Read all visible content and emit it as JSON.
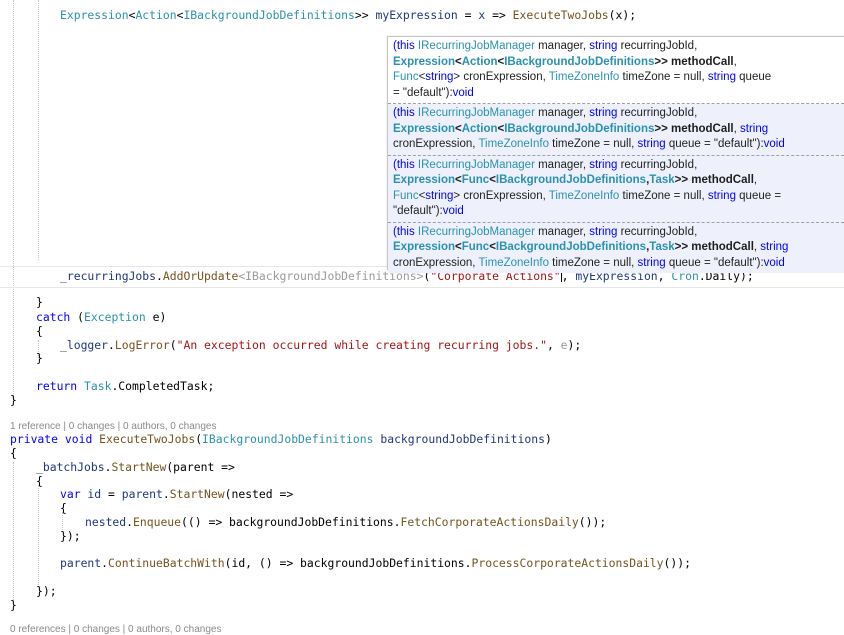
{
  "code": {
    "expr_type": "Expression",
    "expr_lt": "<",
    "expr_action": "Action",
    "expr_lt2": "<",
    "expr_iface": "IBackgroundJobDefinitions",
    "expr_gt": ">> ",
    "expr_var": "myExpression",
    "expr_eq": " = ",
    "expr_x": "x",
    "expr_arrow": " => ",
    "expr_call": "ExecuteTwoJobs",
    "expr_args": "(x);",
    "add_field": "_recurringJobs",
    "add_dot": ".",
    "add_method": "AddOrUpdate",
    "add_generic": "<IBackgroundJobDefinitions>",
    "add_open": "(",
    "add_str": "\"Corporate Actions\"",
    "add_comma": ", ",
    "add_arg2": "myExpression",
    "add_comma2": ", ",
    "add_cron": "Cron",
    "add_rest": ".Daily);",
    "close_brace1": "}",
    "catch_kw": "catch",
    "catch_open": " (",
    "catch_type": "Exception",
    "catch_var": " e)",
    "open_brace1": "{",
    "log_field": "_logger",
    "log_dot": ".",
    "log_method": "LogError",
    "log_open": "(",
    "log_str": "\"An exception occurred while creating recurring jobs.\"",
    "log_comma": ", ",
    "log_e": "e",
    "log_close": ");",
    "close_brace2": "}",
    "ret_kw": "return",
    "ret_sp": " ",
    "ret_type": "Task",
    "ret_rest": ".CompletedTask;",
    "close_brace3": "}",
    "codelens1": "1 reference | 0 changes | 0 authors, 0 changes",
    "m_private": "private",
    "m_void": " void",
    "m_name": " ExecuteTwoJobs",
    "m_open": "(",
    "m_ptype": "IBackgroundJobDefinitions",
    "m_pname": " backgroundJobDefinitions",
    "m_close": ")",
    "open_brace2": "{",
    "b_field": "_batchJobs",
    "b_dot": ".",
    "b_method": "StartNew",
    "b_rest": "(parent =>",
    "open_brace3": "{",
    "v_var": "var",
    "v_id": " id",
    "v_eq": " = ",
    "v_parent": "parent",
    "v_dot": ".",
    "v_method": "StartNew",
    "v_rest": "(nested =>",
    "open_brace4": "{",
    "n_nested": "nested",
    "n_dot": ".",
    "n_method": "Enqueue",
    "n_mid": "(() => backgroundJobDefinitions.",
    "n_call": "FetchCorporateActionsDaily",
    "n_rest": "());",
    "close_inner": "});",
    "c_parent": "parent",
    "c_dot": ".",
    "c_method": "ContinueBatchWith",
    "c_mid": "(id, () => backgroundJobDefinitions.",
    "c_call": "ProcessCorporateActionsDaily",
    "c_rest": "());",
    "close_outer": "});",
    "close_brace4": "}",
    "codelens2": "0 references | 0 changes | 0 authors, 0 changes"
  },
  "popup": {
    "ov1": {
      "this_kw": "(this ",
      "mgr_type": "IRecurringJobManager",
      "mgr": " manager, ",
      "str1": "string",
      "id": " recurringJobId,",
      "expr": "Expression",
      "lt": "<",
      "action": "Action",
      "lt2": "<",
      "iface": "IBackgroundJobDefinitions",
      "gt": ">> ",
      "mc": "methodCall",
      "comma": ",",
      "func": "Func",
      "flt": "<",
      "fstr": "string",
      "fgt": "> cronExpression, ",
      "tz": "TimeZoneInfo",
      "tzrest": " timeZone = null, ",
      "str2": "string",
      "q": " queue",
      "qdef": "= \"default\")",
      "colon": ":",
      "void": "void"
    },
    "ov2": {
      "this_kw": "(this ",
      "mgr_type": "IRecurringJobManager",
      "mgr": " manager, ",
      "str1": "string",
      "id": " recurringJobId,",
      "expr": "Expression",
      "lt": "<",
      "action": "Action",
      "lt2": "<",
      "iface": "IBackgroundJobDefinitions",
      "gt": ">> ",
      "mc": "methodCall",
      "comma": ", ",
      "str3": "string",
      "cron": "cronExpression, ",
      "tz": "TimeZoneInfo",
      "tzrest": " timeZone = null, ",
      "str2": "string",
      "qdef": " queue = \"default\")",
      "colon": ":",
      "void": "void"
    },
    "ov3": {
      "this_kw": "(this ",
      "mgr_type": "IRecurringJobManager",
      "mgr": " manager, ",
      "str1": "string",
      "id": " recurringJobId,",
      "expr": "Expression",
      "lt": "<",
      "func": "Func",
      "lt2": "<",
      "iface": "IBackgroundJobDefinitions",
      "sep": ",",
      "task": "Task",
      "gt": ">> ",
      "mc": "methodCall",
      "comma": ",",
      "func2": "Func",
      "flt": "<",
      "fstr": "string",
      "fgt": "> cronExpression, ",
      "tz": "TimeZoneInfo",
      "tzrest": " timeZone = null, ",
      "str2": "string",
      "q": " queue =",
      "qdef": "\"default\")",
      "colon": ":",
      "void": "void"
    },
    "ov4": {
      "this_kw": "(this ",
      "mgr_type": "IRecurringJobManager",
      "mgr": " manager, ",
      "str1": "string",
      "id": " recurringJobId,",
      "expr": "Expression",
      "lt": "<",
      "func": "Func",
      "lt2": "<",
      "iface": "IBackgroundJobDefinitions",
      "sep": ",",
      "task": "Task",
      "gt": ">> ",
      "mc": "methodCall",
      "comma": ", ",
      "str3": "string",
      "cron": "cronExpression, ",
      "tz": "TimeZoneInfo",
      "tzrest": " timeZone = null, ",
      "str2": "string",
      "qdef": " queue = \"default\")",
      "colon": ":",
      "void": "void"
    }
  }
}
